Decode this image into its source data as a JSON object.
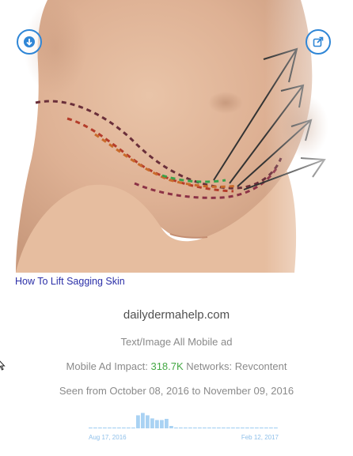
{
  "ad": {
    "title": "How To Lift Sagging Skin",
    "domain": "dailydermahelp.com",
    "type_text": "Text/Image All Mobile ad",
    "impact_label": "Mobile Ad Impact:",
    "impact_value": "318.7K",
    "networks_text": "Networks: Revcontent",
    "seen_text": "Seen from October 08, 2016 to November 09, 2016"
  },
  "buttons": {
    "download_icon": "download-arrow-icon",
    "open_icon": "external-link-icon"
  },
  "colors": {
    "accent_blue": "#2f86d6",
    "link": "#2b2fa8",
    "impact_green": "#45a845",
    "bar_color": "#a9d2f3"
  },
  "chart_data": {
    "type": "bar",
    "x_start_label": "Aug 17, 2016",
    "x_end_label": "Feb 12, 2017",
    "values": [
      0,
      0,
      0,
      0,
      0,
      0,
      0,
      0,
      0,
      0,
      0.55,
      0.65,
      0.55,
      0.42,
      0.35,
      0.35,
      0.4,
      0.1,
      0,
      0,
      0,
      0,
      0,
      0,
      0,
      0,
      0,
      0,
      0,
      0,
      0,
      0,
      0,
      0,
      0,
      0,
      0,
      0,
      0,
      0
    ],
    "ylim": [
      0,
      1
    ]
  }
}
